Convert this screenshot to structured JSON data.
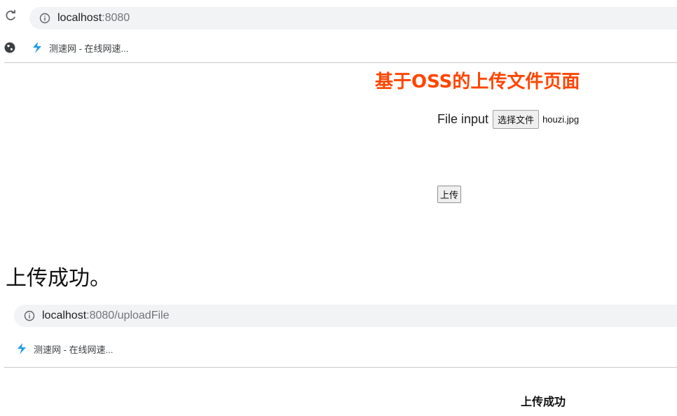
{
  "screenshot1": {
    "address_host": "localhost",
    "address_rest": ":8080",
    "bookmark_label": "测速网 - 在线网速...",
    "page_title": "基于OSS的上传文件页面",
    "file_input_label": "File input",
    "choose_file_button": "选择文件",
    "selected_file_name": "houzi.jpg",
    "upload_button": "上传"
  },
  "caption": "上传成功。",
  "screenshot2": {
    "address_host": "localhost",
    "address_rest": ":8080/uploadFile",
    "bookmark_label": "测速网 - 在线网速...",
    "result_text": "上传成功"
  },
  "colors": {
    "title": "#ff4500",
    "omnibox_bg": "#f1f3f4",
    "speed_icon": "#1e9be9"
  },
  "icons": [
    "reload-icon",
    "info-icon",
    "globe-icon",
    "speedtest-icon"
  ]
}
